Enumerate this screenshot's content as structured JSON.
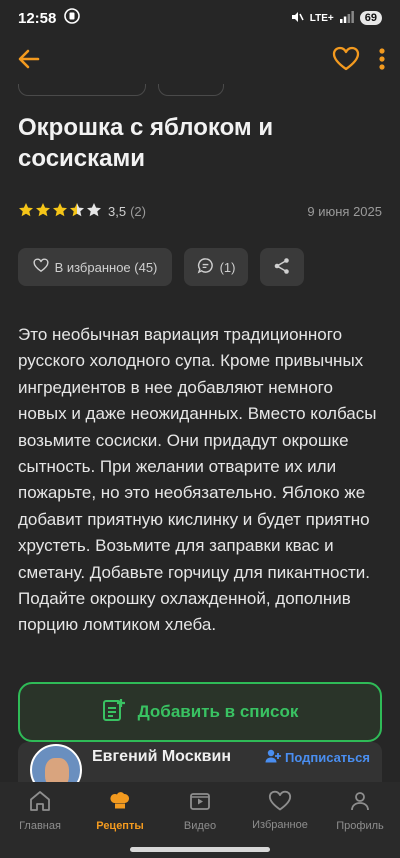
{
  "status_bar": {
    "time": "12:58",
    "network": "LTE+",
    "battery": "69"
  },
  "app_bar": {
    "back_icon": "arrow-left-icon",
    "favorite_icon": "heart-outline-icon",
    "more_icon": "more-vertical-icon"
  },
  "recipe": {
    "title": "Окрошка с яблоком и сосисками",
    "rating_value": "3,5",
    "rating_count": "(2)",
    "rating_stars": 3.5,
    "date": "9 июня 2025",
    "favorites_label": "В избранное (45)",
    "comments_label": "(1)",
    "description": "Это необычная вариация традиционного русского холодного супа. Кроме привычных ингредиентов в нее добавляют немного новых и даже неожиданных. Вместо колбасы возьмите сосиски. Они придадут окрошке сытность. При желании отварите их или пожарьте, но это необязательно. Яблоко же добавит приятную кислинку и будет приятно хрустеть. Возьмите для заправки квас и сметану. Добавьте горчицу для пикантности. Подайте окрошку охлажденной, дополнив порцию ломтиком хлеба."
  },
  "add_to_list": {
    "label": "Добавить в список"
  },
  "author": {
    "name": "Евгений Москвин",
    "subscribe_label": "Подписаться"
  },
  "bottom_nav": [
    {
      "label": "Главная",
      "icon": "home-icon"
    },
    {
      "label": "Рецепты",
      "icon": "chef-hat-icon",
      "active": true
    },
    {
      "label": "Видео",
      "icon": "video-icon"
    },
    {
      "label": "Избранное",
      "icon": "heart-icon"
    },
    {
      "label": "Профиль",
      "icon": "profile-icon"
    }
  ],
  "colors": {
    "accent": "#f39a1f",
    "green": "#2fbb57",
    "blue": "#4a8ef0",
    "star": "#f5c518"
  }
}
